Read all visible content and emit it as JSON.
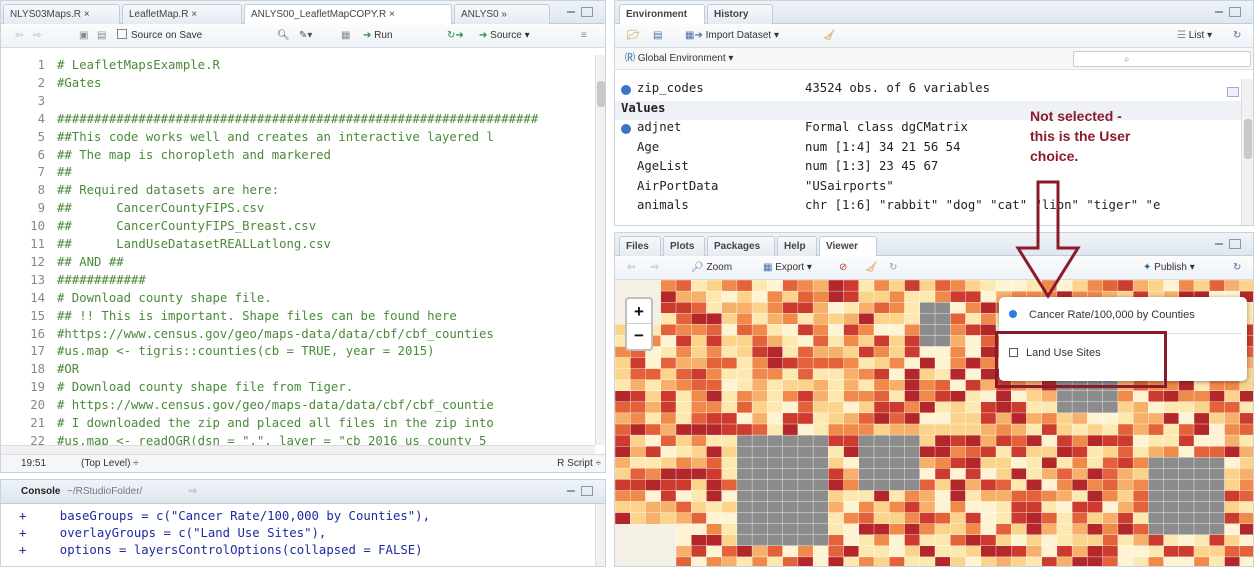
{
  "source_pane": {
    "tabs": [
      "NLYS03Maps.R ×",
      "LeafletMap.R ×",
      "ANLYS00_LeafletMapCOPY.R ×",
      "ANLYS0 »"
    ],
    "toolbar": {
      "source_on_save": "Source on Save",
      "run": "Run",
      "source": "Source"
    },
    "lines": [
      {
        "n": "1",
        "text": "# LeafletMapsExample.R"
      },
      {
        "n": "2",
        "text": "#Gates"
      },
      {
        "n": "3",
        "text": ""
      },
      {
        "n": "4",
        "text": "#################################################################"
      },
      {
        "n": "5",
        "text": "##This code works well and creates an interactive layered l"
      },
      {
        "n": "6",
        "text": "## The map is choropleth and markered"
      },
      {
        "n": "7",
        "text": "##"
      },
      {
        "n": "8",
        "text": "## Required datasets are here:"
      },
      {
        "n": "9",
        "text": "##      CancerCountyFIPS.csv"
      },
      {
        "n": "10",
        "text": "##      CancerCountyFIPS_Breast.csv"
      },
      {
        "n": "11",
        "text": "##      LandUseDatasetREALLatlong.csv"
      },
      {
        "n": "12",
        "text": "## AND ##"
      },
      {
        "n": "13",
        "text": "############"
      },
      {
        "n": "14",
        "text": "# Download county shape file."
      },
      {
        "n": "15",
        "text": "## !! This is important. Shape files can be found here"
      },
      {
        "n": "16",
        "text": "#https://www.census.gov/geo/maps-data/data/cbf/cbf_counties"
      },
      {
        "n": "17",
        "text": "#us.map <- tigris::counties(cb = TRUE, year = 2015)"
      },
      {
        "n": "18",
        "text": "#OR"
      },
      {
        "n": "19",
        "text": "# Download county shape file from Tiger."
      },
      {
        "n": "20",
        "text": "# https://www.census.gov/geo/maps-data/data/cbf/cbf_countie"
      },
      {
        "n": "21",
        "text": "# I downloaded the zip and placed all files in the zip into"
      },
      {
        "n": "22",
        "text": "#us.map <- readOGR(dsn = \".\", layer = \"cb_2016_us_county_5"
      }
    ],
    "status": {
      "position": "19:51",
      "scope": "(Top Level) ÷",
      "type": "R Script ÷"
    }
  },
  "console": {
    "title": "Console",
    "path": "~/RStudioFolder/",
    "lines": [
      {
        "prompt": "+",
        "text": "  baseGroups = c(\"Cancer Rate/100,000 by Counties\"),"
      },
      {
        "prompt": "+",
        "text": "  overlayGroups = c(\"Land Use Sites\"),"
      },
      {
        "prompt": "+",
        "text": "  options = layersControlOptions(collapsed = FALSE)"
      }
    ]
  },
  "env_pane": {
    "tabs": [
      "Environment",
      "History"
    ],
    "import_dataset": "Import Dataset",
    "list_label": "List",
    "scope": "Global Environment",
    "rows": [
      {
        "name": "zip_codes",
        "value": "43524 obs. of 6 variables",
        "icon": true
      },
      {
        "section": "Values"
      },
      {
        "name": "adjnet",
        "value": "Formal class dgCMatrix",
        "icon": true
      },
      {
        "name": "Age",
        "value": "num [1:4] 34 21 56 54"
      },
      {
        "name": "AgeList",
        "value": "num [1:3] 23 45 67"
      },
      {
        "name": "AirPortData",
        "value": "\"USairports\""
      },
      {
        "name": "animals",
        "value": "chr [1:6] \"rabbit\" \"dog\" \"cat\" \"lion\" \"tiger\" \"e"
      }
    ]
  },
  "viewer_pane": {
    "tabs": [
      "Files",
      "Plots",
      "Packages",
      "Help",
      "Viewer"
    ],
    "zoom": "Zoom",
    "export": "Export",
    "publish": "Publish",
    "zoom_in": "+",
    "zoom_out": "−",
    "layers": {
      "base": "Cancer Rate/100,000 by Counties",
      "overlay": "Land Use Sites"
    }
  },
  "annotation": {
    "text_lines": [
      "Not selected -",
      "this is the User",
      "choice."
    ],
    "color": "#8b1a2b"
  },
  "colors": {
    "accent": "#8b1a2b",
    "comment": "#4a8a3a",
    "line_number": "#888888",
    "choropleth_dark": "#b3262a",
    "choropleth_light": "#fde9b0",
    "grey_county": "#8c8c8c"
  }
}
